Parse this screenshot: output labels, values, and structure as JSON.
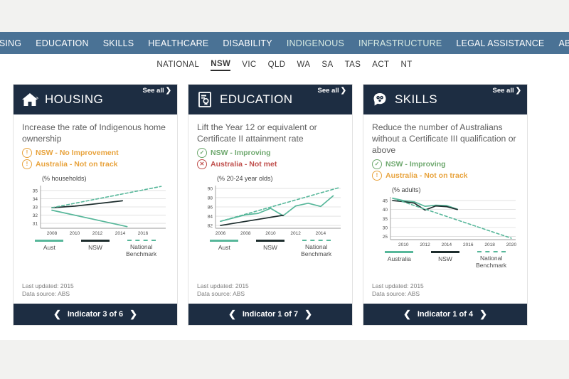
{
  "topnav": {
    "items": [
      {
        "label": "HOUSING",
        "tint": false
      },
      {
        "label": "EDUCATION",
        "tint": false
      },
      {
        "label": "SKILLS",
        "tint": false
      },
      {
        "label": "HEALTHCARE",
        "tint": false
      },
      {
        "label": "DISABILITY",
        "tint": false
      },
      {
        "label": "INDIGENOUS",
        "tint": true
      },
      {
        "label": "INFRASTRUCTURE",
        "tint": true
      },
      {
        "label": "LEGAL ASSISTANCE",
        "tint": false
      },
      {
        "label": "ABOUT",
        "tint": false
      }
    ]
  },
  "states": {
    "items": [
      "NATIONAL",
      "NSW",
      "VIC",
      "QLD",
      "WA",
      "SA",
      "TAS",
      "ACT",
      "NT"
    ],
    "active": "NSW"
  },
  "colors": {
    "navbar": "#4a7295",
    "card_header": "#1d2d42",
    "teal": "#57b79a",
    "dark_line": "#1d2d2d",
    "warn": "#e8a33d",
    "good": "#6fa96f",
    "bad": "#c0504d"
  },
  "cards": [
    {
      "icon": "house-icon",
      "title": "HOUSING",
      "see_all": "See all",
      "goal": "Increase the rate of Indigenous home ownership",
      "statuses": [
        {
          "icon": "warning-icon",
          "label": "NSW - No Improvement",
          "kind": "warn"
        },
        {
          "icon": "warning-icon",
          "label": "Australia - Not on track",
          "kind": "warn"
        }
      ],
      "last_updated": "Last updated: 2015",
      "data_source": "Data source: ABS",
      "indicator": "Indicator 3 of 6",
      "chart_data": {
        "type": "line",
        "title": "",
        "unit_label": "(% households)",
        "xlabel": "",
        "ylabel": "",
        "xlim": [
          2007,
          2018
        ],
        "ylim": [
          30.4,
          35.6
        ],
        "xticks": [
          2008,
          2010,
          2012,
          2014,
          2016
        ],
        "yticks": [
          31,
          32,
          33,
          34,
          35
        ],
        "grid": true,
        "legend_position": "bottom",
        "series": [
          {
            "name": "Aust",
            "style": "solid",
            "color": "#57b79a",
            "x": [
              2008,
              2014.6
            ],
            "y": [
              32.6,
              30.6
            ]
          },
          {
            "name": "NSW",
            "style": "solid",
            "color": "#1d2d2d",
            "x": [
              2008,
              2010,
              2012,
              2014.2
            ],
            "y": [
              32.9,
              33.1,
              33.4,
              33.75
            ]
          },
          {
            "name": "National Benchmark",
            "style": "dashed",
            "color": "#57b79a",
            "x": [
              2008,
              2017.6
            ],
            "y": [
              32.9,
              35.5
            ]
          }
        ]
      }
    },
    {
      "icon": "certificate-icon",
      "title": "EDUCATION",
      "see_all": "See all",
      "goal": "Lift the Year 12 or equivalent or Certificate II attainment rate",
      "statuses": [
        {
          "icon": "check-icon",
          "label": "NSW - Improving",
          "kind": "good"
        },
        {
          "icon": "cross-icon",
          "label": "Australia - Not met",
          "kind": "bad"
        }
      ],
      "last_updated": "Last updated: 2015",
      "data_source": "Data source: ABS",
      "indicator": "Indicator 1 of 7",
      "chart_data": {
        "type": "line",
        "title": "",
        "unit_label": "(% 20-24 year olds)",
        "xlabel": "",
        "ylabel": "",
        "xlim": [
          2005.6,
          2015.6
        ],
        "ylim": [
          81.4,
          90.6
        ],
        "xticks": [
          2006,
          2008,
          2010,
          2012,
          2014
        ],
        "yticks": [
          82,
          84,
          86,
          88,
          90
        ],
        "grid": true,
        "legend_position": "bottom",
        "series": [
          {
            "name": "Aust",
            "style": "solid",
            "color": "#57b79a",
            "x": [
              2006,
              2007,
              2008,
              2009,
              2010,
              2011,
              2012,
              2013,
              2014,
              2015
            ],
            "y": [
              82.9,
              83.6,
              84.3,
              84.6,
              85.7,
              84.1,
              86.2,
              86.8,
              86.1,
              88.4
            ]
          },
          {
            "name": "NSW",
            "style": "solid",
            "color": "#1d2d2d",
            "x": [
              2006,
              2011
            ],
            "y": [
              82.0,
              84.2
            ]
          },
          {
            "name": "National Benchmark",
            "style": "dashed",
            "color": "#57b79a",
            "x": [
              2006,
              2015.4
            ],
            "y": [
              82.9,
              90.1
            ]
          }
        ]
      }
    },
    {
      "icon": "head-gears-icon",
      "title": "SKILLS",
      "see_all": "See all",
      "goal": "Reduce the number of Australians without a Certificate III qualification or above",
      "statuses": [
        {
          "icon": "check-icon",
          "label": "NSW - Improving",
          "kind": "good"
        },
        {
          "icon": "warning-icon",
          "label": "Australia - Not on track",
          "kind": "warn"
        }
      ],
      "last_updated": "Last updated: 2015",
      "data_source": "Data source: ABS",
      "indicator": "Indicator 1 of 4",
      "chart_data": {
        "type": "line",
        "title": "",
        "unit_label": "(% adults)",
        "xlabel": "",
        "ylabel": "",
        "xlim": [
          2008.8,
          2020.4
        ],
        "ylim": [
          23.2,
          47.0
        ],
        "xticks": [
          2010,
          2012,
          2014,
          2016,
          2018,
          2020
        ],
        "yticks": [
          25,
          30,
          35,
          40,
          45
        ],
        "grid": true,
        "legend_position": "bottom",
        "series": [
          {
            "name": "Australia",
            "style": "solid",
            "color": "#57b79a",
            "x": [
              2009,
              2010,
              2011,
              2012,
              2013,
              2014,
              2015
            ],
            "y": [
              46.3,
              45.0,
              44.3,
              41.8,
              42.4,
              42.2,
              40.2
            ]
          },
          {
            "name": "NSW",
            "style": "solid",
            "color": "#1d2d2d",
            "x": [
              2009,
              2010,
              2011,
              2012,
              2013,
              2014,
              2015
            ],
            "y": [
              45.0,
              44.4,
              43.6,
              39.7,
              42.0,
              41.6,
              40.0
            ]
          },
          {
            "name": "National Benchmark",
            "style": "dashed",
            "color": "#57b79a",
            "x": [
              2009,
              2020
            ],
            "y": [
              46.3,
              24.0
            ]
          }
        ]
      }
    }
  ]
}
